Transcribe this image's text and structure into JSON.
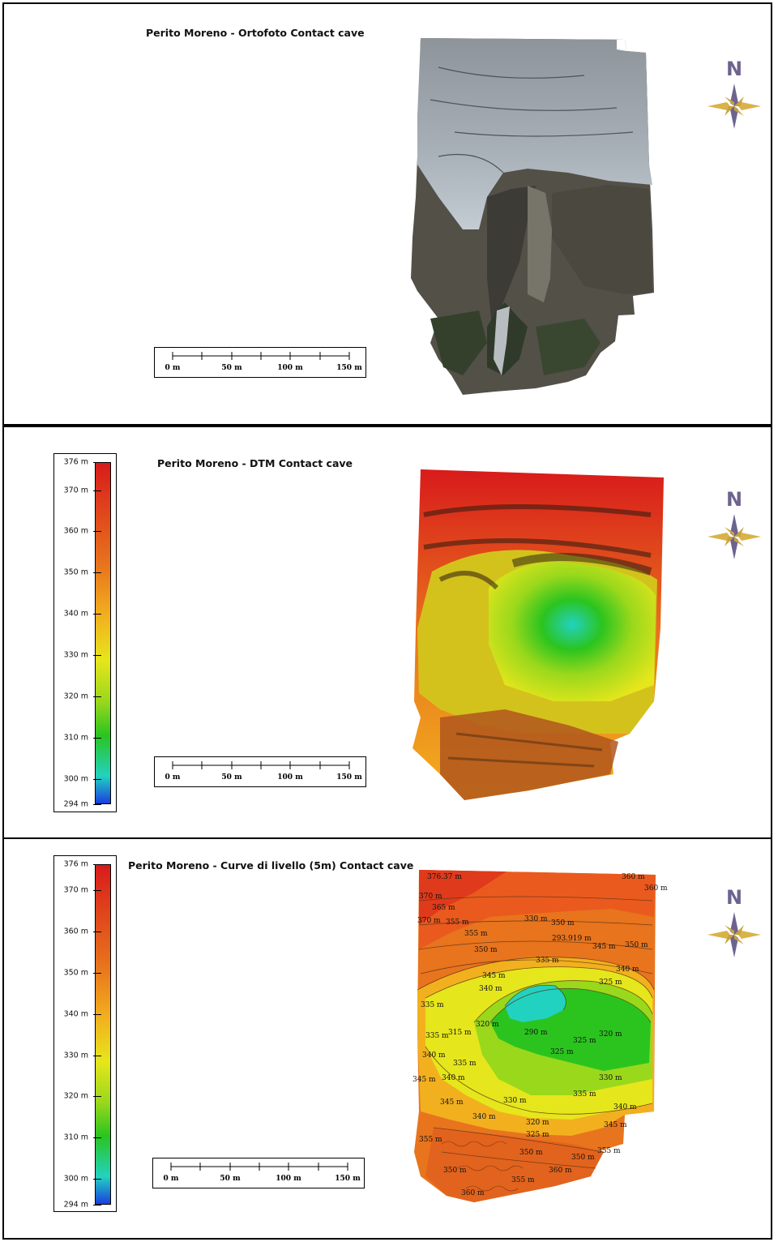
{
  "north_label": "N",
  "scale_labels": [
    "0 m",
    "50 m",
    "100 m",
    "150 m"
  ],
  "legend": {
    "ticks": [
      "376 m",
      "370 m",
      "360 m",
      "350 m",
      "340 m",
      "330 m",
      "320 m",
      "310 m",
      "300 m",
      "294 m"
    ],
    "colors": [
      "#d81b1b",
      "#e8741d",
      "#f2b01e",
      "#e6e61c",
      "#9ad81c",
      "#2bc41f",
      "#22d2c0",
      "#1a3fe0"
    ]
  },
  "panels": [
    {
      "title": "Perito Moreno - Ortofoto Contact cave"
    },
    {
      "title": "Perito Moreno - DTM Contact cave"
    },
    {
      "title": "Perito Moreno - Curve di livello (5m) Contact cave"
    }
  ],
  "contour_labels": [
    "376.37 m",
    "360 m",
    "360 m",
    "370 m",
    "365 m",
    "355 m",
    "370 m",
    "330 m",
    "350 m",
    "355 m",
    "293.919 m",
    "345 m",
    "350 m",
    "335 m",
    "350 m",
    "340 m",
    "345 m",
    "325 m",
    "335 m",
    "340 m",
    "290 m",
    "320 m",
    "335 m",
    "315 m",
    "325 m",
    "320 m",
    "325 m",
    "340 m",
    "335 m",
    "340 m",
    "330 m",
    "345 m",
    "335 m",
    "330 m",
    "345 m",
    "340 m",
    "320 m",
    "340 m",
    "345 m",
    "355 m",
    "325 m",
    "350 m",
    "355 m",
    "350 m",
    "350 m",
    "360 m",
    "355 m",
    "360 m"
  ]
}
